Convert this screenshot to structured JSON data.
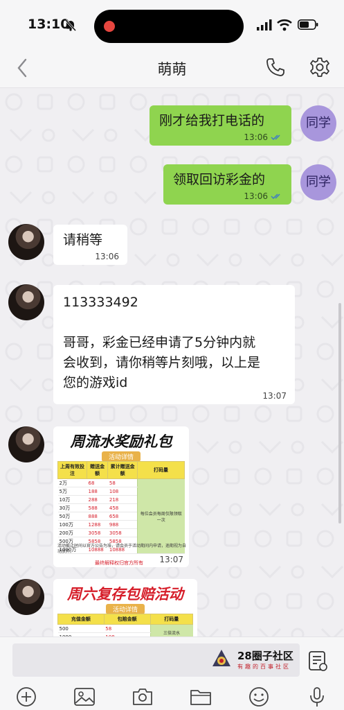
{
  "status_bar": {
    "time": "13:10"
  },
  "header": {
    "title": "萌萌"
  },
  "messages": {
    "m1": {
      "text": "刚才给我打电话的",
      "time": "13:06",
      "sender": "同学"
    },
    "m2": {
      "text": "领取回访彩金的",
      "time": "13:06",
      "sender": "同学"
    },
    "m3": {
      "text": "请稍等",
      "time": "13:06"
    },
    "m4": {
      "line1": "113333492",
      "line2": "哥哥，彩金已经申请了5分钟内就",
      "line3": "会收到，请你稍等片刻哦，以上是",
      "line4": "您的游戏id",
      "time": "13:07"
    },
    "m5": {
      "title": "周流水奖励礼包",
      "subtitle": "活动详情",
      "headers": [
        "上周有效投注",
        "赠送金额",
        "累计赠送金额",
        "打码量"
      ],
      "rows": [
        [
          "2万",
          "68",
          "58"
        ],
        [
          "5万",
          "188",
          "108"
        ],
        [
          "10万",
          "288",
          "218"
        ],
        [
          "30万",
          "588",
          "458"
        ],
        [
          "50万",
          "888",
          "658"
        ],
        [
          "100万",
          "1288",
          "988"
        ],
        [
          "200万",
          "3058",
          "3058"
        ],
        [
          "500万",
          "5858",
          "5858"
        ],
        [
          "1000万",
          "10888",
          "10888"
        ]
      ],
      "side_note": "每位会员每周仅限领取一次",
      "note": "活动截止时间以官方公告为准，请会员于活动期间内申请，逾期视为自动放弃。",
      "footer": "最终解释权归官方所有",
      "time": "13:07"
    },
    "m6": {
      "title": "周六复存包赔活动",
      "subtitle": "活动详情",
      "headers": [
        "充值金额",
        "包赔金额",
        "打码量"
      ],
      "rows": [
        [
          "500",
          "58"
        ],
        [
          "1000",
          "108"
        ]
      ],
      "side_note": "三倍流水"
    }
  },
  "input_bar": {
    "watermark_title": "28圈子社区",
    "watermark_sub": "有趣的百事社区"
  },
  "colors": {
    "outgoing_bubble": "#8fd44f",
    "incoming_bubble": "#ffffff",
    "badge": "#a896dc",
    "background": "#f0eff2"
  },
  "icons": {
    "toolbar": [
      "plus-circle-icon",
      "image-icon",
      "camera-icon",
      "folder-icon",
      "emoji-icon",
      "microphone-icon"
    ]
  }
}
